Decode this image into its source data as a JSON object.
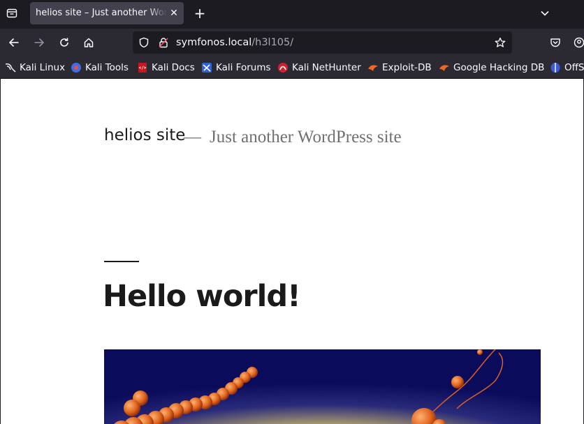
{
  "tabs": [
    {
      "title": "helios site – Just another WordPress site",
      "active": true
    }
  ],
  "navigation": {
    "url_host": "symfonos.local",
    "url_path": "/h3l105/"
  },
  "bookmarks": [
    {
      "label": "Kali Linux",
      "icon": "kali-dragon-icon"
    },
    {
      "label": "Kali Tools",
      "icon": "kali-tools-icon"
    },
    {
      "label": "Kali Docs",
      "icon": "kali-docs-icon"
    },
    {
      "label": "Kali Forums",
      "icon": "kali-forums-icon"
    },
    {
      "label": "Kali NetHunter",
      "icon": "nethunter-icon"
    },
    {
      "label": "Exploit-DB",
      "icon": "exploit-db-icon"
    },
    {
      "label": "Google Hacking DB",
      "icon": "exploit-db-icon"
    },
    {
      "label": "OffS",
      "icon": "offsec-icon"
    }
  ],
  "page": {
    "site_title": "helios site",
    "separator": "—",
    "site_description": "Just another WordPress site",
    "post_title": "Hello world!"
  },
  "colors": {
    "browser_frame": "#1c1b22",
    "toolbar": "#2b2a33",
    "active_tab": "#42414d",
    "page_background": "#ffffff",
    "featured_image_background": "#0b0b5c"
  }
}
